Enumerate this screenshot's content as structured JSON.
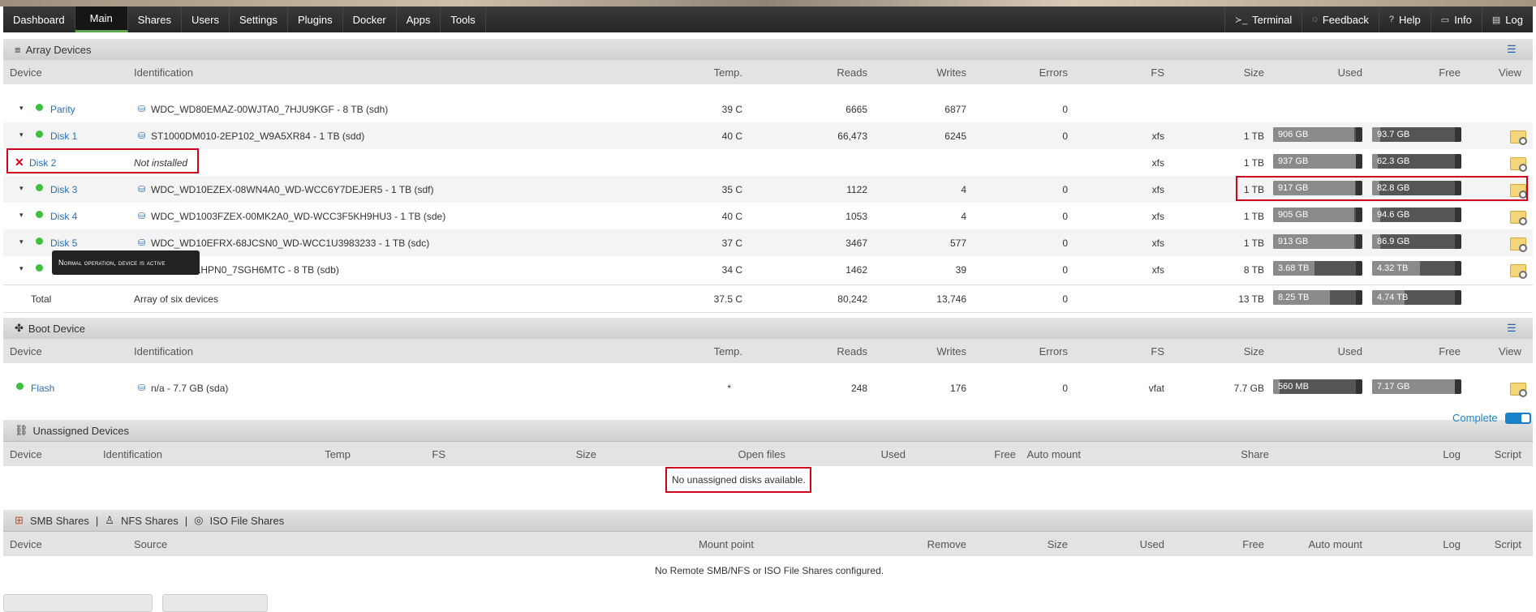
{
  "nav": {
    "items": [
      "Dashboard",
      "Main",
      "Shares",
      "Users",
      "Settings",
      "Plugins",
      "Docker",
      "Apps",
      "Tools"
    ],
    "active": "Main",
    "right": [
      {
        "icon": "terminal-icon",
        "label": "Terminal",
        "glyph": "≻_"
      },
      {
        "icon": "feedback-icon",
        "label": "Feedback",
        "glyph": "◌"
      },
      {
        "icon": "help-icon",
        "label": "Help",
        "glyph": "?"
      },
      {
        "icon": "info-icon",
        "label": "Info",
        "glyph": "▭"
      },
      {
        "icon": "log-icon",
        "label": "Log",
        "glyph": "▤"
      }
    ]
  },
  "array": {
    "title": "Array Devices",
    "headers": [
      "Device",
      "Identification",
      "Temp.",
      "Reads",
      "Writes",
      "Errors",
      "FS",
      "Size",
      "Used",
      "Free",
      "View"
    ],
    "rows": [
      {
        "device": "Parity",
        "id": "WDC_WD80EMAZ-00WJTA0_7HJU9KGF - 8 TB (sdh)",
        "temp": "39 C",
        "reads": "6665",
        "writes": "6877",
        "errors": "0",
        "fs": "",
        "size": "",
        "used": "",
        "used_frac": 0,
        "free": "",
        "free_frac": 0,
        "status": "active",
        "view": false
      },
      {
        "device": "Disk 1",
        "id": "ST1000DM010-2EP102_W9A5XR84 - 1 TB (sdd)",
        "temp": "40 C",
        "reads": "66,473",
        "writes": "6245",
        "errors": "0",
        "fs": "xfs",
        "size": "1 TB",
        "used": "906 GB",
        "used_frac": 0.906,
        "free": "93.7 GB",
        "free_frac": 0.094,
        "status": "active",
        "view": true
      },
      {
        "device": "Disk 2",
        "id": "Not installed",
        "temp": "",
        "reads": "",
        "writes": "",
        "errors": "",
        "fs": "xfs",
        "size": "1 TB",
        "used": "937 GB",
        "used_frac": 0.937,
        "free": "62.3 GB",
        "free_frac": 0.062,
        "status": "missing",
        "view": true
      },
      {
        "device": "Disk 3",
        "id": "WDC_WD10EZEX-08WN4A0_WD-WCC6Y7DEJER5 - 1 TB (sdf)",
        "temp": "35 C",
        "reads": "1122",
        "writes": "4",
        "errors": "0",
        "fs": "xfs",
        "size": "1 TB",
        "used": "917 GB",
        "used_frac": 0.917,
        "free": "82.8 GB",
        "free_frac": 0.083,
        "status": "active",
        "view": true
      },
      {
        "device": "Disk 4",
        "id": "WDC_WD1003FZEX-00MK2A0_WD-WCC3F5KH9HU3 - 1 TB (sde)",
        "temp": "40 C",
        "reads": "1053",
        "writes": "4",
        "errors": "0",
        "fs": "xfs",
        "size": "1 TB",
        "used": "905 GB",
        "used_frac": 0.905,
        "free": "94.6 GB",
        "free_frac": 0.095,
        "status": "active",
        "view": true
      },
      {
        "device": "Disk 5",
        "id": "WDC_WD10EFRX-68JCSN0_WD-WCC1U3983233 - 1 TB (sdc)",
        "temp": "37 C",
        "reads": "3467",
        "writes": "577",
        "errors": "0",
        "fs": "xfs",
        "size": "1 TB",
        "used": "913 GB",
        "used_frac": 0.913,
        "free": "86.9 GB",
        "free_frac": 0.087,
        "status": "active",
        "view": true
      },
      {
        "device": "",
        "id": "0EFAX-68LHPN0_7SGH6MTC - 8 TB (sdb)",
        "temp": "34 C",
        "reads": "1462",
        "writes": "39",
        "errors": "0",
        "fs": "xfs",
        "size": "8 TB",
        "used": "3.68 TB",
        "used_frac": 0.46,
        "free": "4.32 TB",
        "free_frac": 0.54,
        "status": "active",
        "view": true
      }
    ],
    "total": {
      "device": "Total",
      "id": "Array of six devices",
      "temp": "37.5 C",
      "reads": "80,242",
      "writes": "13,746",
      "errors": "0",
      "size": "13 TB",
      "used": "8.25 TB",
      "used_frac": 0.635,
      "free": "4.74 TB",
      "free_frac": 0.365
    },
    "tooltip": "Normal operation, device is active"
  },
  "boot": {
    "title": "Boot Device",
    "headers": [
      "Device",
      "Identification",
      "Temp.",
      "Reads",
      "Writes",
      "Errors",
      "FS",
      "Size",
      "Used",
      "Free",
      "View"
    ],
    "row": {
      "device": "Flash",
      "id": "n/a - 7.7 GB (sda)",
      "temp": "*",
      "reads": "248",
      "writes": "176",
      "errors": "0",
      "fs": "vfat",
      "size": "7.7 GB",
      "used": "560 MB",
      "used_frac": 0.07,
      "free": "7.17 GB",
      "free_frac": 0.93
    }
  },
  "unassigned": {
    "title": "Unassigned Devices",
    "complete_label": "Complete",
    "headers": [
      "Device",
      "Identification",
      "Temp",
      "FS",
      "Size",
      "Open files",
      "Used",
      "Free",
      "Auto mount",
      "Share",
      "Log",
      "Script"
    ],
    "empty_message": "No unassigned disks available."
  },
  "shares": {
    "tabs": [
      "SMB Shares",
      "NFS Shares",
      "ISO File Shares"
    ],
    "separator": "|",
    "headers": [
      "Device",
      "Source",
      "Mount point",
      "Remove",
      "Size",
      "Used",
      "Free",
      "Auto mount",
      "Log",
      "Script"
    ],
    "empty_message": "No Remote SMB/NFS or ISO File Shares configured."
  }
}
